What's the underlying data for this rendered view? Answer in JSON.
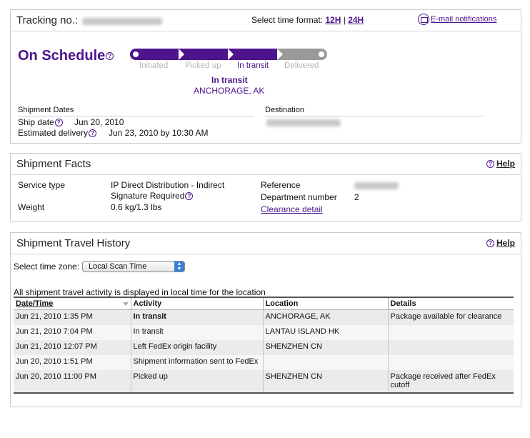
{
  "header": {
    "tracking_label": "Tracking no.:",
    "time_format_label": "Select time format:",
    "format_12h": "12H",
    "format_sep": "|",
    "format_24h": "24H",
    "email_notifications": "E-mail notifications"
  },
  "status": {
    "title": "On Schedule",
    "progress_fraction": 0.75,
    "steps": [
      "Initiated",
      "Picked up",
      "In transit",
      "Delivered"
    ],
    "active_step": "In transit",
    "current_status": "In transit",
    "current_location": "ANCHORAGE, AK"
  },
  "shipment_dates": {
    "section_label": "Shipment Dates",
    "ship_date_label": "Ship date",
    "ship_date_value": "Jun 20, 2010",
    "est_delivery_label": "Estimated delivery",
    "est_delivery_value": "Jun 23, 2010 by 10:30 AM",
    "destination_label": "Destination"
  },
  "facts": {
    "title": "Shipment Facts",
    "help": "Help",
    "service_type_label": "Service type",
    "service_type_value_1": "IP Direct Distribution - Indirect",
    "service_type_value_2": "Signature Required",
    "weight_label": "Weight",
    "weight_value": "0.6 kg/1.3 lbs",
    "reference_label": "Reference",
    "department_label": "Department number",
    "department_value": "2",
    "clearance_link": "Clearance detail"
  },
  "history": {
    "title": "Shipment Travel History",
    "help": "Help",
    "tz_label": "Select time zone:",
    "tz_value": "Local Scan Time",
    "note": "All shipment travel activity is displayed in local time for the location",
    "columns": [
      "Date/Time",
      "Activity",
      "Location",
      "Details"
    ],
    "rows": [
      {
        "datetime": "Jun 21, 2010 1:35 PM",
        "activity": "In transit",
        "location": "ANCHORAGE, AK",
        "details": "Package available for clearance"
      },
      {
        "datetime": "Jun 21, 2010 7:04 PM",
        "activity": "In transit",
        "location": "LANTAU ISLAND HK",
        "details": ""
      },
      {
        "datetime": "Jun 21, 2010 12:07 PM",
        "activity": "Left FedEx origin facility",
        "location": "SHENZHEN CN",
        "details": ""
      },
      {
        "datetime": "Jun 20, 2010 1:51 PM",
        "activity": "Shipment information sent to FedEx",
        "location": "",
        "details": ""
      },
      {
        "datetime": "Jun 20, 2010 11:00 PM",
        "activity": "Picked up",
        "location": "SHENZHEN CN",
        "details": "Package received after FedEx cutoff"
      }
    ]
  },
  "colors": {
    "brand_purple": "#4d148c",
    "progress_gray": "#9a9a9a"
  }
}
